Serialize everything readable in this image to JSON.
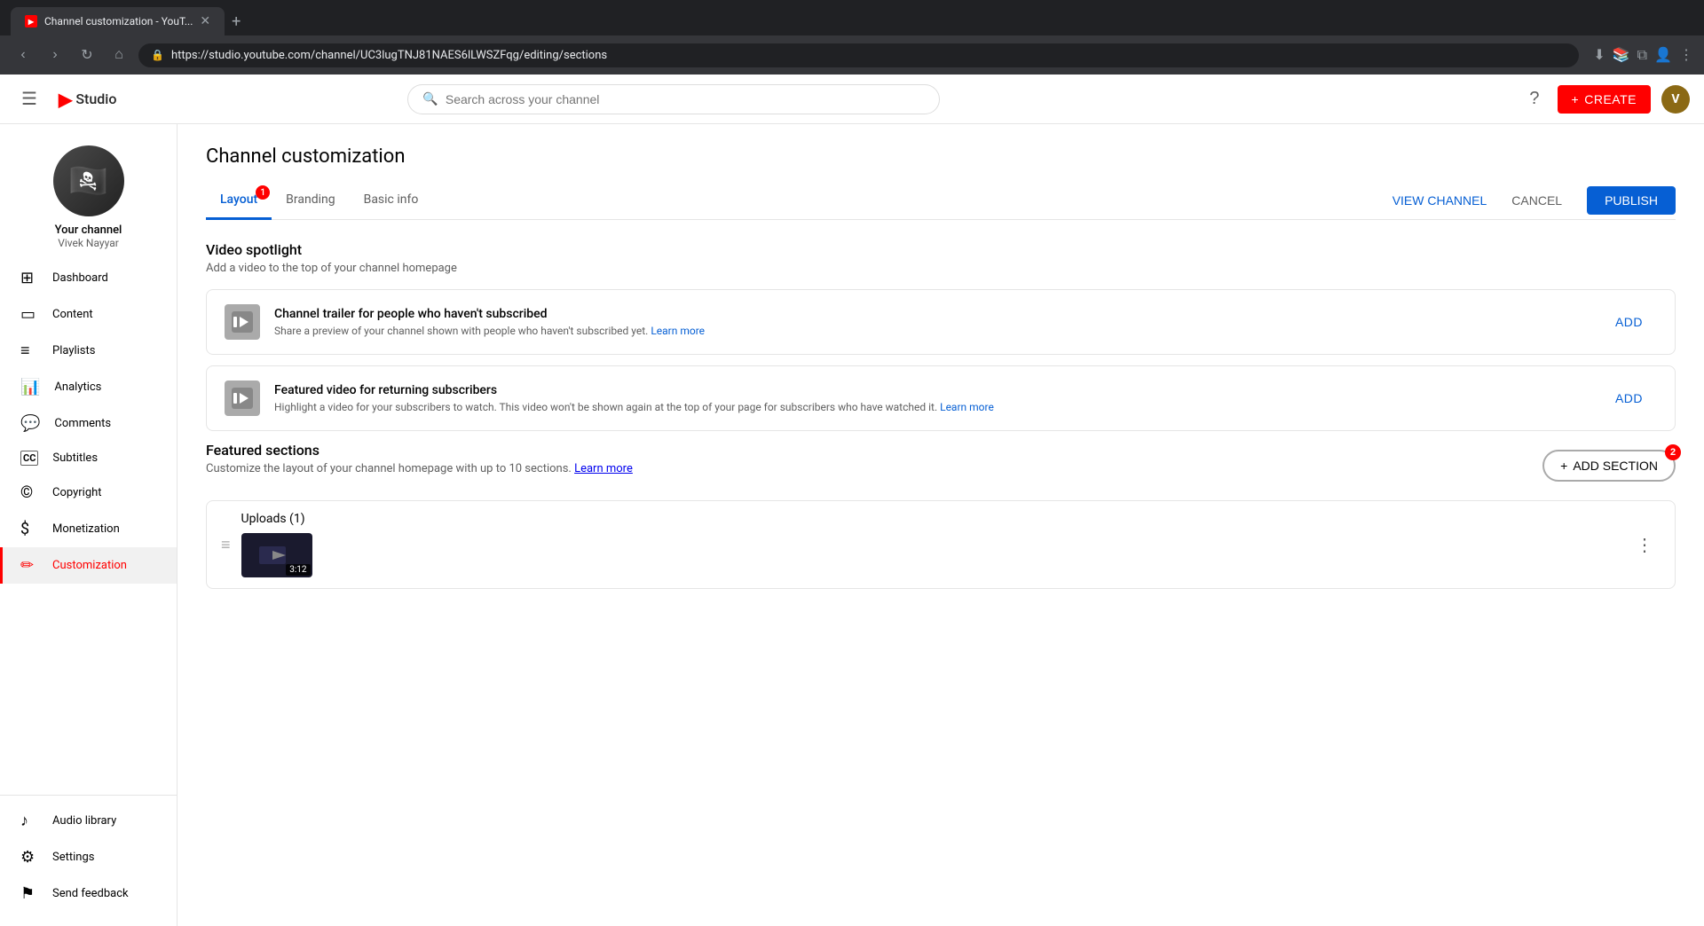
{
  "browser": {
    "tab_title": "Channel customization - YouT...",
    "url": "https://studio.youtube.com/channel/UC3lugTNJ81NAES6lLWSZFqg/editing/sections",
    "new_tab_label": "+"
  },
  "header": {
    "menu_label": "☰",
    "logo_yt": "▶",
    "logo_text": "Studio",
    "search_placeholder": "Search across your channel",
    "help_label": "?",
    "create_label": "CREATE",
    "create_icon": "+"
  },
  "sidebar": {
    "channel_name": "Your channel",
    "channel_handle": "Vivek Nayyar",
    "nav_items": [
      {
        "id": "dashboard",
        "label": "Dashboard",
        "icon": "⊞"
      },
      {
        "id": "content",
        "label": "Content",
        "icon": "▭"
      },
      {
        "id": "playlists",
        "label": "Playlists",
        "icon": "☰"
      },
      {
        "id": "analytics",
        "label": "Analytics",
        "icon": "📊"
      },
      {
        "id": "comments",
        "label": "Comments",
        "icon": "💬"
      },
      {
        "id": "subtitles",
        "label": "Subtitles",
        "icon": "CC"
      },
      {
        "id": "copyright",
        "label": "Copyright",
        "icon": "©"
      },
      {
        "id": "monetization",
        "label": "Monetization",
        "icon": "$"
      },
      {
        "id": "customization",
        "label": "Customization",
        "icon": "✏",
        "active": true
      }
    ],
    "bottom_items": [
      {
        "id": "audio-library",
        "label": "Audio library",
        "icon": "♪"
      },
      {
        "id": "settings",
        "label": "Settings",
        "icon": "⚙"
      },
      {
        "id": "send-feedback",
        "label": "Send feedback",
        "icon": "⚑"
      }
    ]
  },
  "page": {
    "title": "Channel customization",
    "tabs": [
      {
        "id": "layout",
        "label": "Layout",
        "active": true,
        "badge": "1"
      },
      {
        "id": "branding",
        "label": "Branding",
        "active": false
      },
      {
        "id": "basic-info",
        "label": "Basic info",
        "active": false
      }
    ],
    "view_channel_label": "VIEW CHANNEL",
    "cancel_label": "CANCEL",
    "publish_label": "PUBLISH",
    "video_spotlight": {
      "title": "Video spotlight",
      "desc": "Add a video to the top of your channel homepage",
      "channel_trailer": {
        "icon": "🎬",
        "title": "Channel trailer for people who haven't subscribed",
        "desc": "Share a preview of your channel shown with people who haven't subscribed yet.",
        "learn_more": "Learn more",
        "add_label": "ADD"
      },
      "featured_video": {
        "icon": "🎬",
        "title": "Featured video for returning subscribers",
        "desc": "Highlight a video for your subscribers to watch. This video won't be shown again at the top of your page for subscribers who have watched it.",
        "learn_more": "Learn more",
        "add_label": "ADD"
      }
    },
    "featured_sections": {
      "title": "Featured sections",
      "desc": "Customize the layout of your channel homepage with up to 10 sections.",
      "learn_more": "Learn more",
      "add_section_label": "ADD SECTION",
      "add_section_badge": "2",
      "uploads": {
        "title": "Uploads (1)",
        "time": "3:12"
      }
    }
  }
}
